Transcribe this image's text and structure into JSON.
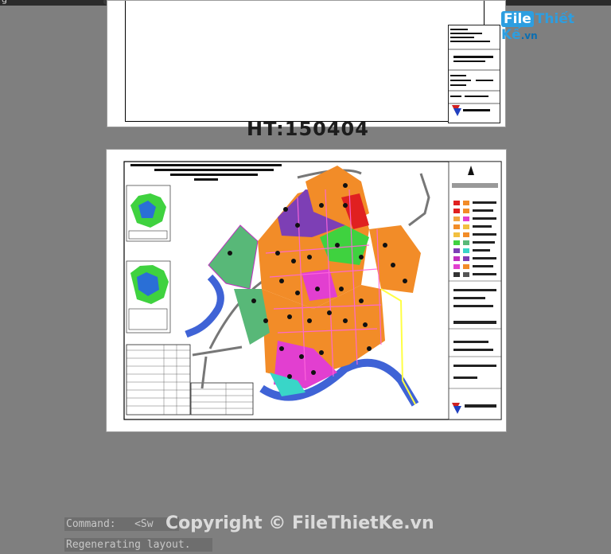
{
  "app": {
    "tab_text": "g"
  },
  "drawing": {
    "caption": "HT:150404"
  },
  "logo": {
    "part1": "File",
    "part2": "Thiết Kế",
    "part3": ".vn"
  },
  "command_line": {
    "command_label": "Command:",
    "command_value": "<Sw",
    "history": "Regenerating layout."
  },
  "watermark": {
    "text": "Copyright © FileThietKe.vn"
  },
  "colors": {
    "background": "#7f7f7f",
    "sheet": "#ffffff",
    "river": "#3f63d6",
    "zone_orange": "#f28c28",
    "zone_purple": "#7d3fb5",
    "zone_green": "#3fd23f",
    "zone_magenta": "#e23fd0",
    "zone_red": "#e02020",
    "zone_cyan": "#39d6c8",
    "zone_park": "#58b878"
  }
}
